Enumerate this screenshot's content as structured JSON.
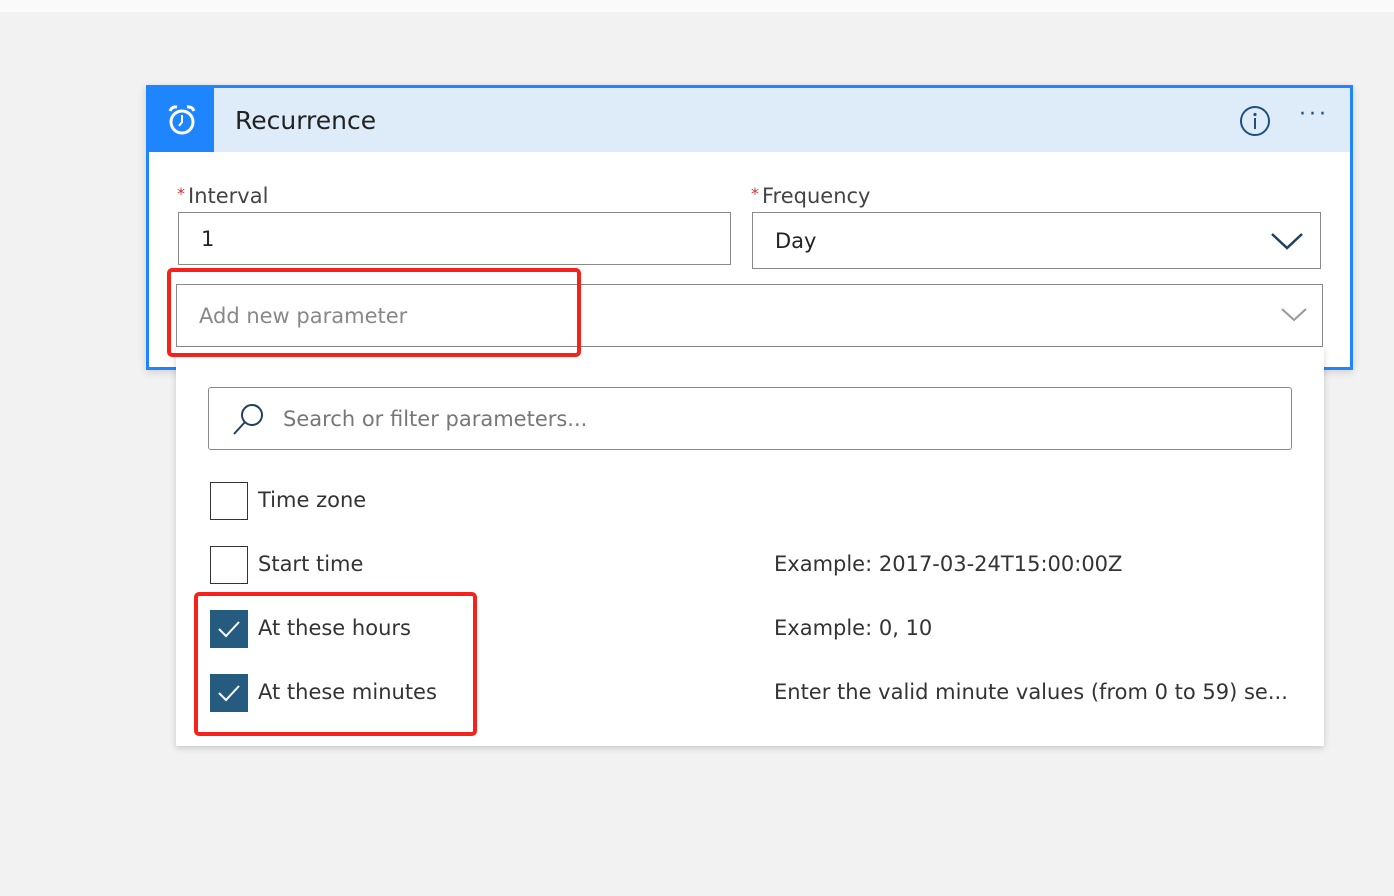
{
  "card": {
    "title": "Recurrence",
    "icon": "alarm-clock-icon",
    "accent_color": "#1f85ff",
    "header_bg": "#deecf9",
    "interval": {
      "label": "Interval",
      "required_mark": "*",
      "value": "1"
    },
    "frequency": {
      "label": "Frequency",
      "required_mark": "*",
      "value": "Day"
    },
    "add_parameter_placeholder": "Add new parameter"
  },
  "dropdown": {
    "search_placeholder": "Search or filter parameters...",
    "items": [
      {
        "label": "Time zone",
        "checked": false,
        "description": ""
      },
      {
        "label": "Start time",
        "checked": false,
        "description": "Example: 2017-03-24T15:00:00Z"
      },
      {
        "label": "At these hours",
        "checked": true,
        "description": "Example: 0, 10"
      },
      {
        "label": "At these minutes",
        "checked": true,
        "description": "Enter the valid minute values (from 0 to 59) se..."
      }
    ],
    "checked_color": "#245b7f"
  },
  "annotation_color": "#f5221b"
}
